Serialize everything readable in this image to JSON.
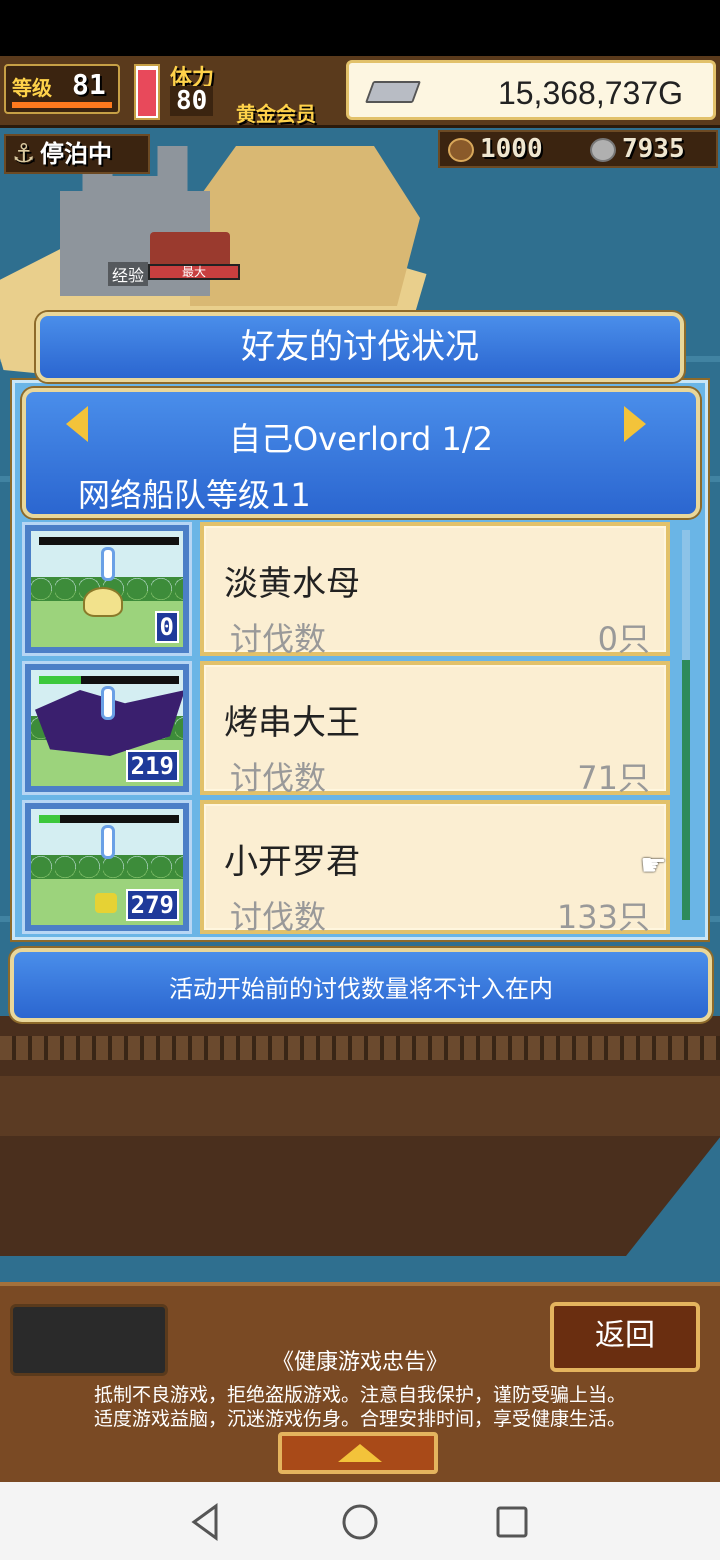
{
  "hud": {
    "level_label": "等级",
    "level_value": "81",
    "stamina_label": "体力",
    "stamina_value": "80",
    "stamina_fill": 0.95,
    "member_label": "黄金会员",
    "gold_value": "15,368,737G",
    "status_label": "停泊中",
    "resource_1": "1000",
    "resource_2": "7935",
    "exp_tag": "经验",
    "exp_text": "最大"
  },
  "dialog": {
    "title": "好友的讨伐状况",
    "header_title": "自己Overlord 1/2",
    "header_sub": "网络船队等级11",
    "rows": [
      {
        "name": "淡黄水母",
        "label": "讨伐数",
        "count": "0只",
        "thumb_count": "0",
        "hp": 0.0
      },
      {
        "name": "烤串大王",
        "label": "讨伐数",
        "count": "71只",
        "thumb_count": "219",
        "hp": 0.3
      },
      {
        "name": "小开罗君",
        "label": "讨伐数",
        "count": "133只",
        "thumb_count": "279",
        "hp": 0.15
      }
    ],
    "notice": "活动开始前的讨伐数量将不计入在内"
  },
  "footer": {
    "back_label": "返回",
    "advice_title": "《健康游戏忠告》",
    "advice_line1": "抵制不良游戏，拒绝盗版游戏。注意自我保护，谨防受骗上当。",
    "advice_line2": "适度游戏益脑，沉迷游戏伤身。合理安排时间，享受健康生活。"
  },
  "colors": {
    "dialog_blue": "#2b66d0",
    "card_bg": "#fbeed2",
    "gold_frame": "#e2c16a"
  },
  "icons": [
    "anchor-icon",
    "silver-bar-icon",
    "arrow-left-icon",
    "arrow-right-icon",
    "pointer-hand-icon",
    "up-arrow-icon",
    "back-nav-icon",
    "home-nav-icon",
    "recents-nav-icon"
  ]
}
